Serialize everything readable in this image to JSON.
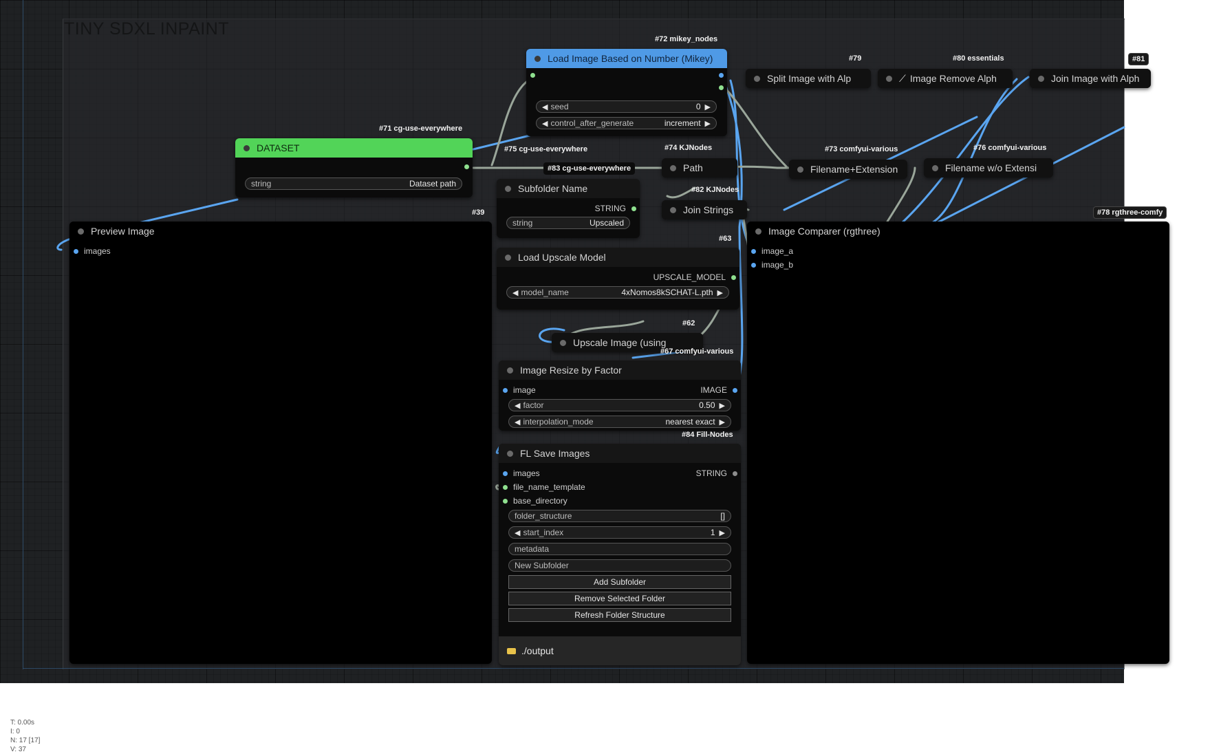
{
  "group": {
    "title": "TINY SDXL INPAINT"
  },
  "nodes": {
    "load_image": {
      "title": "Load Image Based on Number (Mikey)",
      "badge": "#72 mikey_nodes",
      "widgets": {
        "seed_label": "seed",
        "seed_value": "0",
        "cag_label": "control_after_generate",
        "cag_value": "increment"
      }
    },
    "dataset": {
      "title": "DATASET",
      "badge": "#71 cg-use-everywhere",
      "widget_label": "string",
      "widget_value": "Dataset path"
    },
    "split_image": {
      "title": "Split Image with Alp",
      "badge": "#79"
    },
    "remove_alpha": {
      "title": "Image Remove Alph",
      "badge": "#80 essentials"
    },
    "join_image": {
      "title": "Join Image with Alph",
      "badge": "#81"
    },
    "path": {
      "title": "Path",
      "badge": "#74 KJNodes"
    },
    "use_everywhere_75": {
      "badge": "#75 cg-use-everywhere"
    },
    "use_everywhere_83": {
      "badge": "#83 cg-use-everywhere"
    },
    "filename_ext": {
      "title": "Filename+Extension",
      "badge": "#73 comfyui-various"
    },
    "filename_wo": {
      "title": "Filename w/o Extensi",
      "badge": "#76 comfyui-various"
    },
    "subfolder": {
      "title": "Subfolder Name",
      "output": "STRING",
      "widget_label": "string",
      "widget_value": "Upscaled"
    },
    "join_strings": {
      "title": "Join Strings",
      "badge": "#82 KJNodes"
    },
    "preview": {
      "title": "Preview Image",
      "badge": "#39",
      "input": "images"
    },
    "comparer": {
      "title": "Image Comparer (rgthree)",
      "badge": "#78 rgthree-comfy",
      "input_a": "image_a",
      "input_b": "image_b"
    },
    "upscale_model": {
      "title": "Load Upscale Model",
      "badge": "#63",
      "output": "UPSCALE_MODEL",
      "widget_label": "model_name",
      "widget_value": "4xNomos8kSCHAT-L.pth"
    },
    "upscale_image": {
      "title": "Upscale Image (using",
      "badge": "#62"
    },
    "resize": {
      "title": "Image Resize by Factor",
      "badge": "#67 comfyui-various",
      "input": "image",
      "output": "IMAGE",
      "factor_label": "factor",
      "factor_value": "0.50",
      "interp_label": "interpolation_mode",
      "interp_value": "nearest exact"
    },
    "save": {
      "title": "FL Save Images",
      "badge": "#84 Fill-Nodes",
      "inputs": [
        "images",
        "file_name_template",
        "base_directory"
      ],
      "output": "STRING",
      "folder_structure_label": "folder_structure",
      "folder_structure_value": "[]",
      "start_index_label": "start_index",
      "start_index_value": "1",
      "metadata_label": "metadata",
      "new_subfolder_label": "New Subfolder",
      "buttons": [
        "Add Subfolder",
        "Remove Selected Folder",
        "Refresh Folder Structure"
      ],
      "folder_path": "./output"
    }
  },
  "stats": {
    "t": "T: 0.00s",
    "i": "I: 0",
    "n": "N: 17 [17]",
    "v": "V: 37"
  },
  "colors": {
    "wire_image": "#5aa5f0",
    "wire_string": "#9aa69a",
    "header_blue": "#4f9ae6",
    "header_green": "#52d458"
  }
}
